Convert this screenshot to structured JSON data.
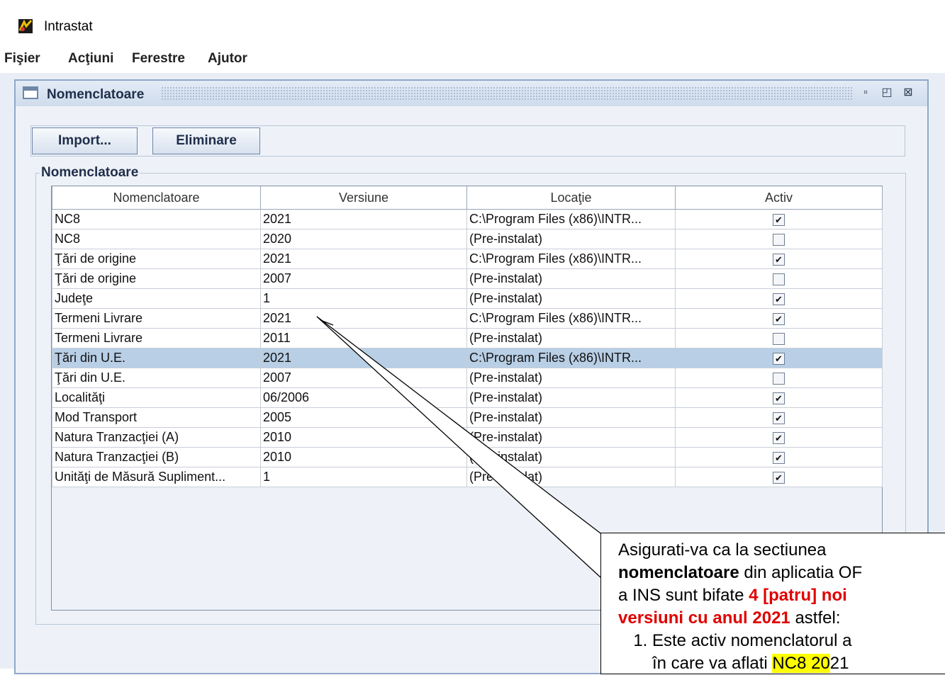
{
  "app": {
    "title": "Intrastat"
  },
  "menu": [
    "Fişier",
    "Acţiuni",
    "Ferestre",
    "Ajutor"
  ],
  "frame": {
    "title": "Nomenclatoare"
  },
  "toolbar": {
    "import_label": "Import...",
    "delete_label": "Eliminare"
  },
  "group": {
    "label": "Nomenclatoare"
  },
  "table": {
    "headers": [
      "Nomenclatoare",
      "Versiune",
      "Locaţie",
      "Activ"
    ],
    "rows": [
      {
        "name": "NC8",
        "version": "2021",
        "location": "C:\\Program Files (x86)\\INTR...",
        "active": true
      },
      {
        "name": "NC8",
        "version": "2020",
        "location": "(Pre-instalat)",
        "active": false
      },
      {
        "name": "Ţări de origine",
        "version": "2021",
        "location": "C:\\Program Files (x86)\\INTR...",
        "active": true
      },
      {
        "name": "Ţări de origine",
        "version": "2007",
        "location": "(Pre-instalat)",
        "active": false
      },
      {
        "name": "Judeţe",
        "version": "1",
        "location": "(Pre-instalat)",
        "active": true
      },
      {
        "name": "Termeni Livrare",
        "version": "2021",
        "location": "C:\\Program Files (x86)\\INTR...",
        "active": true
      },
      {
        "name": "Termeni Livrare",
        "version": "2011",
        "location": "(Pre-instalat)",
        "active": false
      },
      {
        "name": "Ţări din U.E.",
        "version": "2021",
        "location": "C:\\Program Files (x86)\\INTR...",
        "active": true,
        "selected": true
      },
      {
        "name": "Ţări din U.E.",
        "version": "2007",
        "location": "(Pre-instalat)",
        "active": false
      },
      {
        "name": "Localităţi",
        "version": "06/2006",
        "location": "(Pre-instalat)",
        "active": true
      },
      {
        "name": "Mod Transport",
        "version": "2005",
        "location": "(Pre-instalat)",
        "active": true
      },
      {
        "name": "Natura Tranzacţiei (A)",
        "version": "2010",
        "location": "(Pre-instalat)",
        "active": true
      },
      {
        "name": "Natura Tranzacţiei (B)",
        "version": "2010",
        "location": "(Pre-instalat)",
        "active": true
      },
      {
        "name": "Unităţi de Măsură Supliment...",
        "version": "1",
        "location": "(Pre-instalat)",
        "active": true
      }
    ]
  },
  "callout": {
    "line1": "Asigurati-va ca la sectiunea",
    "bold_word": "nomenclatoare",
    "line2_rest": " din aplicatia OF",
    "line3_start": "a INS sunt bifate ",
    "red_text_a": "4 [patru] noi",
    "red_text_b": "versiuni cu anul 2021",
    "line4_rest": " astfel:",
    "item1": "Este activ nomenclatorul a",
    "item2_start": "în care va aflati ",
    "item2_hl": "NC8 20",
    "item2_end": "21"
  },
  "colors": {
    "selection": "#b8cfe6",
    "frame_border": "#8fa8c8",
    "callout_red": "#e00000",
    "highlight": "#ffff00"
  }
}
